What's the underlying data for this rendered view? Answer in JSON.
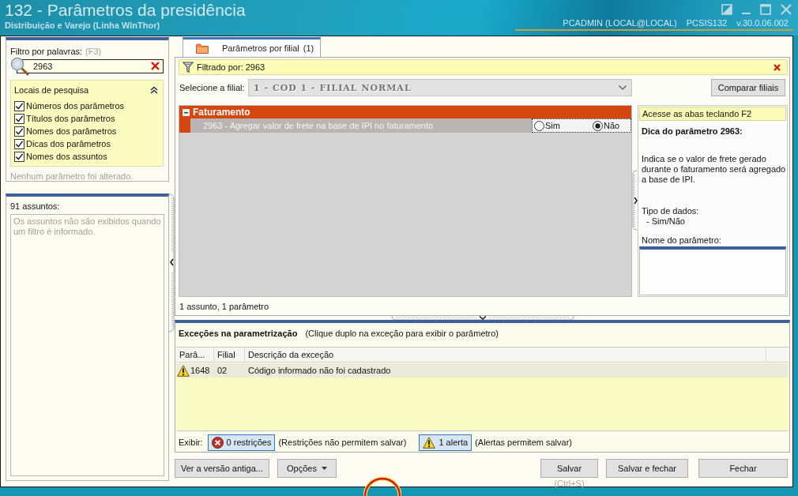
{
  "window": {
    "title": "132 - Parâmetros da presidência",
    "subtitle": "Distribuição e Varejo (Linha WinThor)",
    "user": "PCADMIN (LOCAL@LOCAL)",
    "program": "PCSIS132",
    "version": "v.30.0.06.002"
  },
  "filter_panel": {
    "label": "Filtro por palavras:",
    "shortcut": "(F3)",
    "search": {
      "value": "2963"
    },
    "search_places": {
      "title": "Locais de pesquisa",
      "expanded": true,
      "options": [
        {
          "label": "Números dos parâmetros",
          "checked": true
        },
        {
          "label": "Títulos dos parâmetros",
          "checked": true
        },
        {
          "label": "Nomes dos parâmetros",
          "checked": true
        },
        {
          "label": "Dicas dos parâmetros",
          "checked": true
        },
        {
          "label": "Nomes dos assuntos",
          "checked": true
        }
      ]
    },
    "status": "Nenhum parâmetro foi alterado."
  },
  "subjects_panel": {
    "count": "91 assuntos:",
    "message": "Os assuntos não são exibidos quando um filtro é informado."
  },
  "tabs": [
    {
      "label": "Parâmetros por filial",
      "count": "(1)",
      "selected": true
    }
  ],
  "filter_bar": {
    "text": "Filtrado por: 2963"
  },
  "branch": {
    "label": "Selecione a filial:",
    "value": "1 - COD 1 - FILIAL NORMAL",
    "disabled": true,
    "compare_button": "Comparar filiais"
  },
  "groups": [
    {
      "name": "Faturamento",
      "expanded": true,
      "parameters": [
        {
          "text": "2963 - Agregar valor de frete na base de IPI no faturamento",
          "options": [
            {
              "label": "Sim",
              "selected": false
            },
            {
              "label": "Não",
              "selected": true
            }
          ]
        }
      ]
    }
  ],
  "tip_panel": {
    "hint": "Acesse as abas teclando F2",
    "title": "Dica do parâmetro 2963:",
    "description": "Indica se o valor de frete gerado durante o faturamento será agregado a base de IPI.",
    "data_type_label": "Tipo de dados:",
    "data_type": "- Sim/Não",
    "name_label": "Nome do parâmetro:"
  },
  "summary": "1 assunto, 1 parâmetro",
  "exceptions": {
    "title": "Exceções na parametrização",
    "hint": "(Clique duplo na exceção para exibir o parâmetro)",
    "columns": [
      "Parâ...",
      "Filial",
      "Descrição da exceção"
    ],
    "rows": [
      {
        "kind": "alert",
        "selected": true,
        "cells": [
          "1648",
          "02",
          "Código informado não foi cadastrado"
        ]
      }
    ]
  },
  "show_bar": {
    "label": "Exibir:",
    "toggles": [
      {
        "kind": "restriction",
        "label": "0 restrições",
        "pressed": true,
        "note": "(Restrições não permitem salvar)"
      },
      {
        "kind": "alert",
        "label": "1 alerta",
        "pressed": true,
        "note": "(Alertas permitem salvar)"
      }
    ]
  },
  "buttons": {
    "left": [
      {
        "label": "Ver a versão antiga...",
        "dropdown": false
      },
      {
        "label": "Opções",
        "dropdown": true
      }
    ],
    "right": [
      {
        "label": "Salvar",
        "shortcut": "(Ctrl+S)"
      },
      {
        "label": "Salvar e fechar"
      },
      {
        "label": "Fechar"
      }
    ]
  }
}
